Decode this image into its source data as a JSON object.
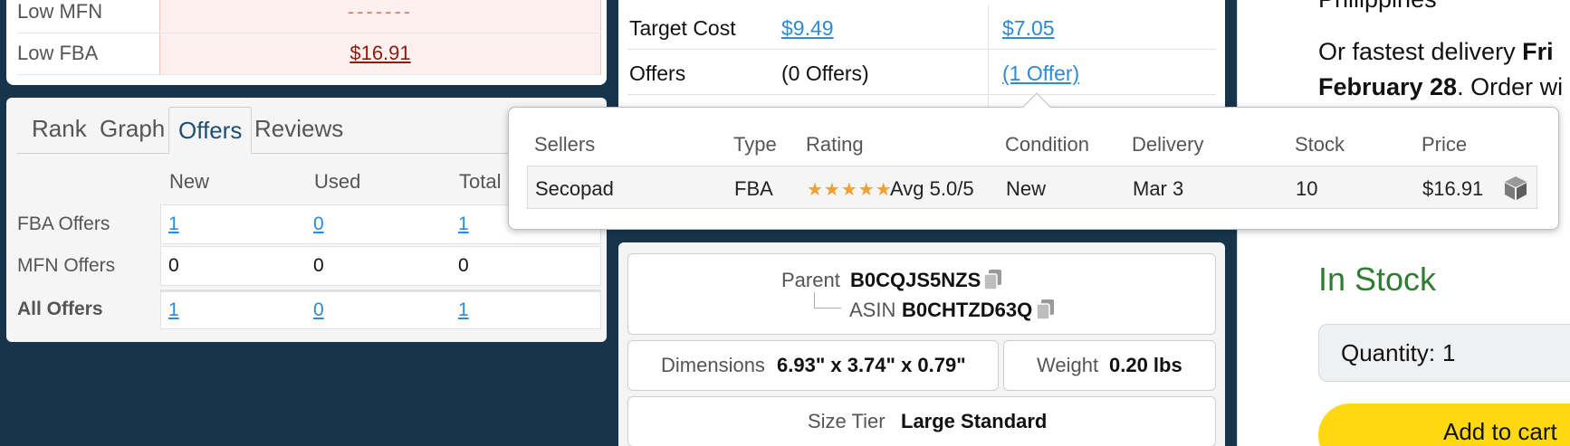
{
  "low_price": {
    "rows": [
      {
        "label": "Low MFN",
        "value": "-------"
      },
      {
        "label": "Low FBA",
        "value": "$16.91"
      }
    ]
  },
  "offers_panel": {
    "tabs": [
      "Rank",
      "Graph",
      "Offers",
      "Reviews"
    ],
    "active_tab": "Offers",
    "columns": [
      "New",
      "Used",
      "Total"
    ],
    "rows": [
      {
        "label": "FBA Offers",
        "new": "1",
        "used": "0",
        "total": "1"
      },
      {
        "label": "MFN Offers",
        "new": "0",
        "used": "0",
        "total": "0"
      },
      {
        "label": "All Offers",
        "new": "1",
        "used": "0",
        "total": "1"
      }
    ]
  },
  "mid": {
    "target_cost_label": "Target Cost",
    "target_cost_1": "$9.49",
    "target_cost_2": "$7.05",
    "offers_label": "Offers",
    "offers_1": "(0 Offers)",
    "offers_2": "(1 Offer)"
  },
  "popover": {
    "headers": {
      "sellers": "Sellers",
      "type": "Type",
      "rating": "Rating",
      "condition": "Condition",
      "delivery": "Delivery",
      "stock": "Stock",
      "price": "Price"
    },
    "row": {
      "seller": "Secopad",
      "type": "FBA",
      "stars": "★★★★★",
      "rating": "Avg 5.0/5",
      "condition": "New",
      "delivery": "Mar 3",
      "stock": "10",
      "price": "$16.91"
    }
  },
  "ids": {
    "parent_label": "Parent",
    "parent_value": "B0CQJS5NZS",
    "asin_label": "ASIN",
    "asin_value": "B0CHTZD63Q",
    "dimensions_label": "Dimensions",
    "dimensions_value": "6.93\" x 3.74\" x 0.79\"",
    "weight_label": "Weight",
    "weight_value": "0.20 lbs",
    "size_tier_label": "Size Tier",
    "size_tier_value": "Large Standard"
  },
  "buybox": {
    "line1": "Philippines",
    "line2_pre": "Or fastest delivery ",
    "line2_bold": "Fri",
    "line3_bold": "February 28",
    "line3_post": ". Order wi",
    "stock": "In Stock",
    "qty_label": "Quantity:",
    "qty_value": "1",
    "cart_label": "Add to cart"
  },
  "colors": {
    "background": "#17344d",
    "link": "#2d8ad6",
    "in_stock": "#2f7d31",
    "cart": "#ffd814",
    "star": "#f0a033"
  }
}
